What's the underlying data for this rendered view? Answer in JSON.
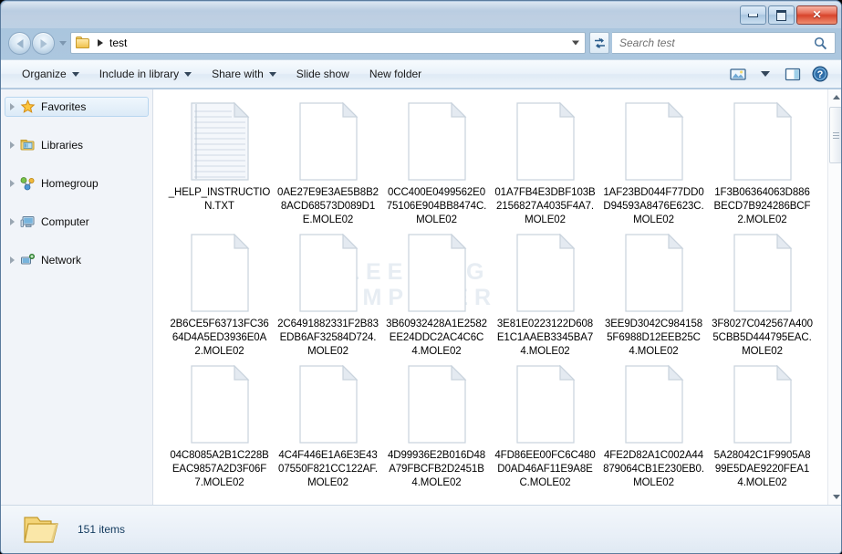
{
  "window": {
    "title": "",
    "controls": {
      "minimize_label": "",
      "maximize_label": "",
      "close_label": "✕"
    }
  },
  "address_bar": {
    "crumb": "test",
    "folder_icon": "folder-icon",
    "dropdown_icon": "chevron-down-icon",
    "refresh_icon": "refresh-icon"
  },
  "search": {
    "placeholder": "Search test",
    "value": "",
    "icon": "search-icon"
  },
  "command_bar": {
    "items": [
      {
        "label": "Organize",
        "has_caret": true
      },
      {
        "label": "Include in library",
        "has_caret": true
      },
      {
        "label": "Share with",
        "has_caret": true
      },
      {
        "label": "Slide show",
        "has_caret": false
      },
      {
        "label": "New folder",
        "has_caret": false
      }
    ],
    "right_icons": [
      {
        "name": "change-view-icon"
      },
      {
        "name": "view-caret-icon"
      },
      {
        "name": "preview-pane-icon"
      },
      {
        "name": "help-icon"
      }
    ]
  },
  "nav_pane": {
    "items": [
      {
        "label": "Favorites",
        "icon": "star-icon",
        "selected": true
      },
      {
        "label": "Libraries",
        "icon": "libraries-icon",
        "selected": false
      },
      {
        "label": "Homegroup",
        "icon": "homegroup-icon",
        "selected": false
      },
      {
        "label": "Computer",
        "icon": "computer-icon",
        "selected": false
      },
      {
        "label": "Network",
        "icon": "network-icon",
        "selected": false
      }
    ]
  },
  "content": {
    "watermark": "BLEEPING\nCOMPUTER",
    "files": [
      {
        "name": "_HELP_INSTRUCTION.TXT",
        "icon": "text-file-icon"
      },
      {
        "name": "0AE27E9E3AE5B8B28ACD68573D089D1E.MOLE02",
        "icon": "blank-file-icon"
      },
      {
        "name": "0CC400E0499562E075106E904BB8474C.MOLE02",
        "icon": "blank-file-icon"
      },
      {
        "name": "01A7FB4E3DBF103B2156827A4035F4A7.MOLE02",
        "icon": "blank-file-icon"
      },
      {
        "name": "1AF23BD044F77DD0D94593A8476E623C.MOLE02",
        "icon": "blank-file-icon"
      },
      {
        "name": "1F3B06364063D886BECD7B924286BCF2.MOLE02",
        "icon": "blank-file-icon"
      },
      {
        "name": "2B6CE5F63713FC3664D4A5ED3936E0A2.MOLE02",
        "icon": "blank-file-icon"
      },
      {
        "name": "2C6491882331F2B83EDB6AF32584D724.MOLE02",
        "icon": "blank-file-icon"
      },
      {
        "name": "3B60932428A1E2582EE24DDC2AC4C6C4.MOLE02",
        "icon": "blank-file-icon"
      },
      {
        "name": "3E81E0223122D608E1C1AAEB3345BA74.MOLE02",
        "icon": "blank-file-icon"
      },
      {
        "name": "3EE9D3042C9841585F6988D12EEB25C4.MOLE02",
        "icon": "blank-file-icon"
      },
      {
        "name": "3F8027C042567A4005CBB5D444795EAC.MOLE02",
        "icon": "blank-file-icon"
      },
      {
        "name": "04C8085A2B1C228BEAC9857A2D3F06F7.MOLE02",
        "icon": "blank-file-icon"
      },
      {
        "name": "4C4F446E1A6E3E4307550F821CC122AF.MOLE02",
        "icon": "blank-file-icon"
      },
      {
        "name": "4D99936E2B016D48A79FBCFB2D2451B4.MOLE02",
        "icon": "blank-file-icon"
      },
      {
        "name": "4FD86EE00FC6C480D0AD46AF11E9A8EC.MOLE02",
        "icon": "blank-file-icon"
      },
      {
        "name": "4FE2D82A1C002A44879064CB1E230EB0.MOLE02",
        "icon": "blank-file-icon"
      },
      {
        "name": "5A28042C1F9905A899E5DAE9220FEA14.MOLE02",
        "icon": "blank-file-icon"
      }
    ]
  },
  "scrollbar": {
    "up_icon": "scroll-up-icon",
    "down_icon": "scroll-down-icon"
  },
  "status_bar": {
    "item_count": "151 items",
    "folder_icon": "open-folder-icon"
  },
  "colors": {
    "accent": "#b0c8e0",
    "close_button": "#d8442c",
    "watermark": "#e7edf3",
    "status_text": "#123a5e"
  }
}
